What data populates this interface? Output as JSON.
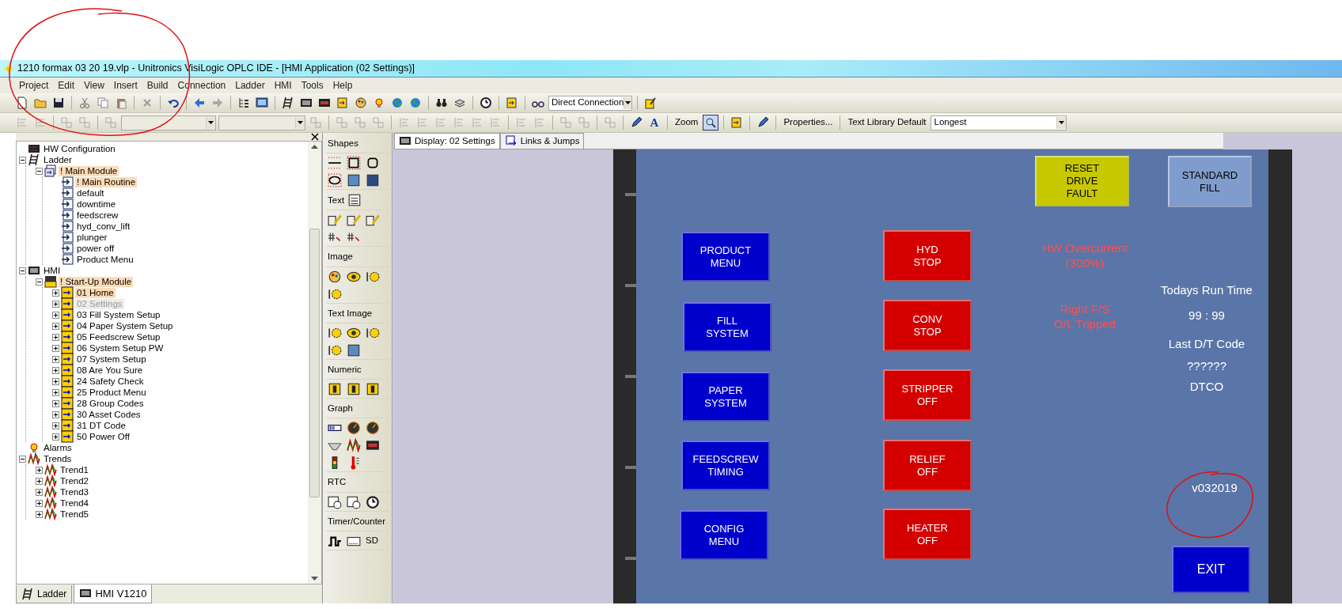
{
  "window": {
    "title": "1210 formax 03 20 19.vlp - Unitronics VisiLogic OPLC IDE - [HMI Application (02 Settings)]"
  },
  "menu": [
    "Project",
    "Edit",
    "View",
    "Insert",
    "Build",
    "Connection",
    "Ladder",
    "HMI",
    "Tools",
    "Help"
  ],
  "toolbar": {
    "connection": "Direct Connection",
    "font_button": "A",
    "zoom_label": "Zoom",
    "zoom_pressed": true,
    "properties": "Properties...",
    "text_library_label": "Text Library Default",
    "text_library": "Longest"
  },
  "project_tree": {
    "items": [
      {
        "label": "HW Configuration",
        "kind": "hardware",
        "highlighted": false,
        "dimmed": false
      },
      {
        "label": "Ladder",
        "kind": "ladder",
        "expanded": true,
        "highlighted": false,
        "dimmed": false,
        "children": [
          {
            "label": "! Main Module",
            "kind": "module",
            "expanded": true,
            "highlighted": true,
            "dimmed": false,
            "children": [
              {
                "label": "! Main Routine",
                "kind": "routine",
                "highlighted": true,
                "dimmed": false
              },
              {
                "label": "default",
                "kind": "routine",
                "highlighted": false,
                "dimmed": false
              },
              {
                "label": "downtime",
                "kind": "routine",
                "highlighted": false,
                "dimmed": false
              },
              {
                "label": "feedscrew",
                "kind": "routine",
                "highlighted": false,
                "dimmed": false
              },
              {
                "label": "hyd_conv_lift",
                "kind": "routine",
                "highlighted": false,
                "dimmed": false
              },
              {
                "label": "plunger",
                "kind": "routine",
                "highlighted": false,
                "dimmed": false
              },
              {
                "label": "power off",
                "kind": "routine",
                "highlighted": false,
                "dimmed": false
              },
              {
                "label": "Product Menu",
                "kind": "routine",
                "highlighted": false,
                "dimmed": false
              }
            ]
          }
        ]
      },
      {
        "label": "HMI",
        "kind": "hmi",
        "expanded": true,
        "highlighted": false,
        "dimmed": false,
        "children": [
          {
            "label": "! Start-Up Module",
            "kind": "hmi_module",
            "expanded": true,
            "highlighted": true,
            "dimmed": false,
            "children": [
              {
                "label": "01 Home",
                "kind": "display",
                "expanded": false,
                "highlighted": true,
                "dimmed": false
              },
              {
                "label": "02 Settings",
                "kind": "display",
                "expanded": false,
                "highlighted": false,
                "dimmed": true
              },
              {
                "label": "03 Fill System Setup",
                "kind": "display",
                "expanded": false,
                "highlighted": false,
                "dimmed": false
              },
              {
                "label": "04 Paper System Setup",
                "kind": "display",
                "expanded": false,
                "highlighted": false,
                "dimmed": false
              },
              {
                "label": "05 Feedscrew Setup",
                "kind": "display",
                "expanded": false,
                "highlighted": false,
                "dimmed": false
              },
              {
                "label": "06 System Setup PW",
                "kind": "display",
                "expanded": false,
                "highlighted": false,
                "dimmed": false
              },
              {
                "label": "07 System Setup",
                "kind": "display",
                "expanded": false,
                "highlighted": false,
                "dimmed": false
              },
              {
                "label": "08 Are You Sure",
                "kind": "display",
                "expanded": false,
                "highlighted": false,
                "dimmed": false
              },
              {
                "label": "24 Safety Check",
                "kind": "display",
                "expanded": false,
                "highlighted": false,
                "dimmed": false
              },
              {
                "label": "25 Product Menu",
                "kind": "display",
                "expanded": false,
                "highlighted": false,
                "dimmed": false
              },
              {
                "label": "28 Group Codes",
                "kind": "display",
                "expanded": false,
                "highlighted": false,
                "dimmed": false
              },
              {
                "label": "30 Asset Codes",
                "kind": "display",
                "expanded": false,
                "highlighted": false,
                "dimmed": false
              },
              {
                "label": "31 DT Code",
                "kind": "display",
                "expanded": false,
                "highlighted": false,
                "dimmed": false
              },
              {
                "label": "50 Power Off",
                "kind": "display",
                "expanded": false,
                "highlighted": false,
                "dimmed": false
              }
            ]
          }
        ]
      },
      {
        "label": "Alarms",
        "kind": "alarm",
        "highlighted": false,
        "dimmed": false
      },
      {
        "label": "Trends",
        "kind": "trend",
        "expanded": true,
        "highlighted": false,
        "dimmed": false,
        "children": [
          {
            "label": "Trend1",
            "kind": "trend",
            "expanded": false,
            "highlighted": false,
            "dimmed": false
          },
          {
            "label": "Trend2",
            "kind": "trend",
            "expanded": false,
            "highlighted": false,
            "dimmed": false
          },
          {
            "label": "Trend3",
            "kind": "trend",
            "expanded": false,
            "highlighted": false,
            "dimmed": false
          },
          {
            "label": "Trend4",
            "kind": "trend",
            "expanded": false,
            "highlighted": false,
            "dimmed": false
          },
          {
            "label": "Trend5",
            "kind": "trend",
            "expanded": false,
            "highlighted": false,
            "dimmed": false
          }
        ]
      }
    ]
  },
  "bottom_tabs": [
    {
      "label": "Ladder",
      "selected": false
    },
    {
      "label": "HMI V1210",
      "selected": true
    }
  ],
  "toolbox": {
    "sections": [
      {
        "label": "Shapes"
      },
      {
        "label": "Text"
      },
      {
        "label": "Image"
      },
      {
        "label": "Text Image"
      },
      {
        "label": "Numeric"
      },
      {
        "label": "Graph"
      },
      {
        "label": "RTC"
      },
      {
        "label": "Timer/Counter"
      }
    ],
    "timer_text": "SD"
  },
  "editor_tabs": [
    {
      "label": "Display: 02 Settings",
      "selected": true
    },
    {
      "label": "Links & Jumps",
      "selected": false
    }
  ],
  "hmi_screen": {
    "buttons": [
      {
        "label": "RESET\nDRIVE\nFAULT",
        "color": "#c8c800"
      },
      {
        "label": "STANDARD\nFILL",
        "color": "#7f9ccc"
      },
      {
        "label": "PRODUCT\nMENU",
        "color": "#0000cc"
      },
      {
        "label": "FILL\nSYSTEM",
        "color": "#0000cc"
      },
      {
        "label": "PAPER\nSYSTEM",
        "color": "#0000cc"
      },
      {
        "label": "FEEDSCREW\nTIMING",
        "color": "#0000cc"
      },
      {
        "label": "CONFIG\nMENU",
        "color": "#0000cc"
      },
      {
        "label": "HYD\nSTOP",
        "color": "#d40000"
      },
      {
        "label": "CONV\nSTOP",
        "color": "#d40000"
      },
      {
        "label": "STRIPPER\nOFF",
        "color": "#d40000"
      },
      {
        "label": "RELIEF\nOFF",
        "color": "#d40000"
      },
      {
        "label": "HEATER\nOFF",
        "color": "#d40000"
      },
      {
        "label": "EXIT",
        "color": "#0000cc"
      }
    ],
    "texts": [
      {
        "text": "HW Overcurrent\n(300%)",
        "color": "#ff5050"
      },
      {
        "text": "Right F/S\nO/L Tripped",
        "color": "#ff5050"
      },
      {
        "text": "Todays Run Time",
        "color": "#ffffff"
      },
      {
        "text": "99 : 99",
        "color": "#ffffff"
      },
      {
        "text": "Last D/T Code",
        "color": "#ffffff"
      },
      {
        "text": "??????",
        "color": "#ffffff"
      },
      {
        "text": "DTCO",
        "color": "#ffffff"
      },
      {
        "text": "v032019",
        "color": "#ffffff"
      }
    ]
  }
}
